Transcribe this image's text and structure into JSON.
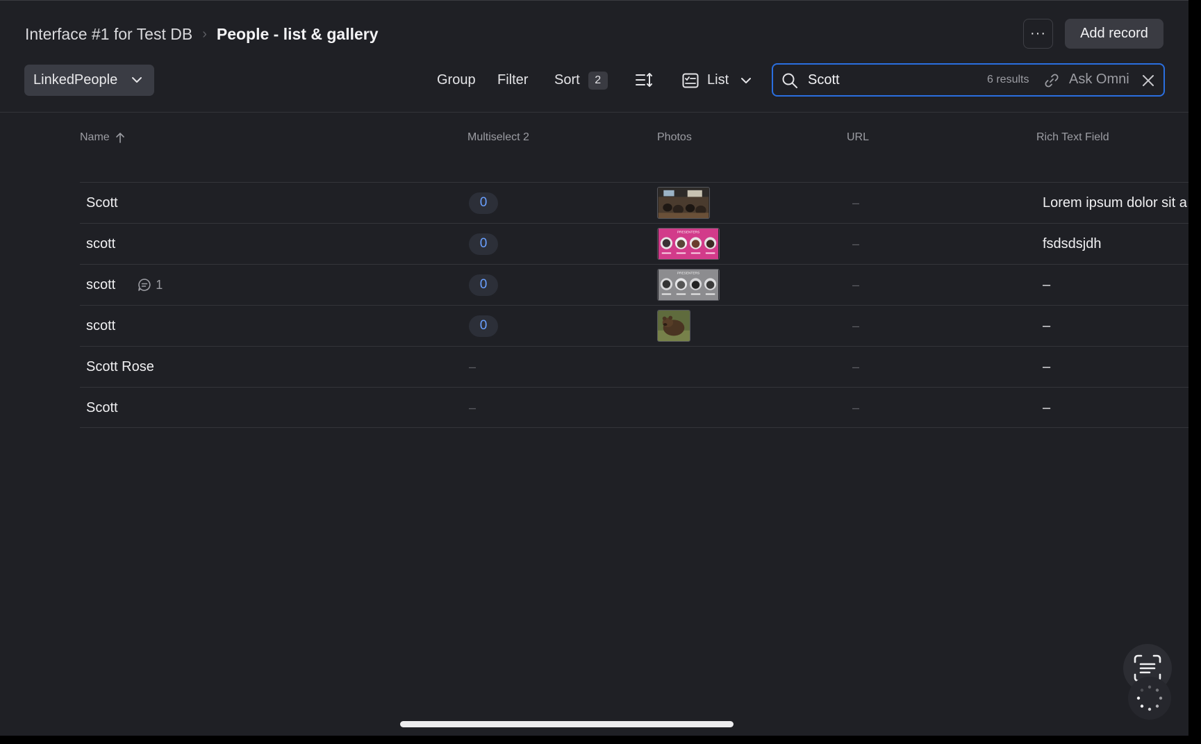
{
  "header": {
    "breadcrumb_parent": "Interface #1 for Test DB",
    "breadcrumb_separator": "›",
    "page_title": "People - list & gallery",
    "more_label": "···",
    "add_record_label": "Add record"
  },
  "toolbar": {
    "source_label": "LinkedPeople",
    "group_label": "Group",
    "filter_label": "Filter",
    "sort_label": "Sort",
    "sort_count": "2",
    "view_label": "List"
  },
  "search": {
    "value": "Scott",
    "results": "6 results",
    "ask_label": "Ask Omni"
  },
  "table": {
    "columns": [
      {
        "label": "Name"
      },
      {
        "label": "Multiselect 2"
      },
      {
        "label": "Photos"
      },
      {
        "label": "URL"
      },
      {
        "label": "Rich Text Field"
      }
    ],
    "rows": [
      {
        "name": "Scott",
        "multiselect": "0",
        "photo": "conference-room",
        "url": "–",
        "rich_text": "Lorem ipsum dolor sit a"
      },
      {
        "name": "scott",
        "multiselect": "0",
        "photo": "presenters-pink",
        "url": "–",
        "rich_text": "fsdsdsjdh"
      },
      {
        "name": "scott",
        "comments": "1",
        "multiselect": "0",
        "photo": "presenters-gray",
        "url": "–",
        "rich_text": "–"
      },
      {
        "name": "scott",
        "multiselect": "0",
        "photo": "bear",
        "url": "–",
        "rich_text": "–"
      },
      {
        "name": "Scott Rose",
        "multiselect": "–",
        "photo": "",
        "url": "–",
        "rich_text": "–"
      },
      {
        "name": "Scott",
        "multiselect": "–",
        "photo": "",
        "url": "–",
        "rich_text": "–"
      }
    ]
  },
  "photo_thumbnail_text": "PRESENTERS",
  "colors": {
    "background": "#1f2025",
    "accent_blue": "#2a6fe0",
    "pill_text": "#6aa0ff",
    "pink_thumb": "#d23b8a"
  }
}
